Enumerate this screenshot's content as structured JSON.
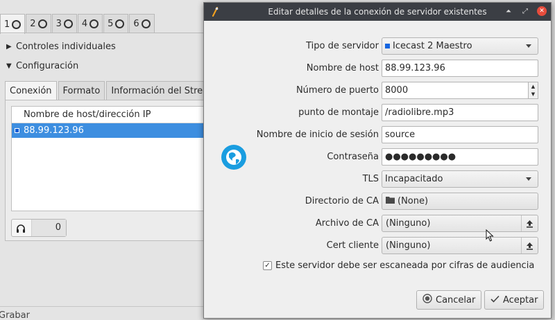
{
  "background_app": {
    "channel_tabs": [
      {
        "label": "1",
        "active": true
      },
      {
        "label": "2",
        "active": false
      },
      {
        "label": "3",
        "active": false
      },
      {
        "label": "4",
        "active": false
      },
      {
        "label": "5",
        "active": false
      },
      {
        "label": "6",
        "active": false
      }
    ],
    "expander_individual": "Controles individuales",
    "expander_config": "Configuración",
    "inner_tabs": [
      "Conexión",
      "Formato",
      "Información del Stream"
    ],
    "host_list_header": "Nombre de host/dirección IP",
    "host_list_rows": [
      "88.99.123.96"
    ],
    "listeners_count": "0",
    "record_label": "Grabar"
  },
  "dialog": {
    "title": "Editar detalles de la conexión de servidor existentes",
    "fields": {
      "server_type_label": "Tipo de servidor",
      "server_type_value": "Icecast 2 Maestro",
      "host_label": "Nombre de host",
      "host_value": "88.99.123.96",
      "port_label": "Número de puerto",
      "port_value": "8000",
      "mount_label": "punto de montaje",
      "mount_value": "/radiolibre.mp3",
      "login_label": "Nombre de inicio de sesión",
      "login_value": "source",
      "password_label": "Contraseña",
      "password_value": "●●●●●●●●●",
      "tls_label": "TLS",
      "tls_value": "Incapacitado",
      "ca_dir_label": "Directorio de CA",
      "ca_dir_value": "(None)",
      "ca_file_label": "Archivo de CA",
      "ca_file_value": "(Ninguno)",
      "client_cert_label": "Cert cliente",
      "client_cert_value": "(Ninguno)"
    },
    "scan_checkbox_label": "Este servidor debe ser escaneada por cifras de audiencia",
    "scan_checked": true,
    "cancel_label": "Cancelar",
    "accept_label": "Aceptar"
  },
  "colors": {
    "titlebar": "#3b3e44",
    "selection": "#3d8ee0",
    "close_button": "#e74c3c",
    "globe": "#1a9de0"
  }
}
